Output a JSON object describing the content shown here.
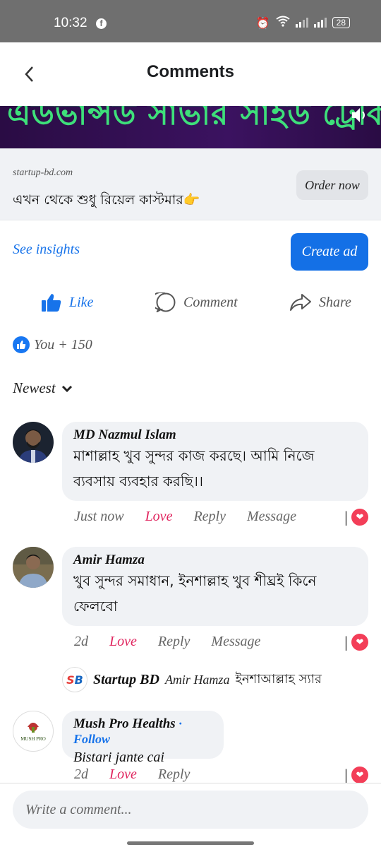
{
  "status_bar": {
    "time": "10:32",
    "battery": "28"
  },
  "header": {
    "title": "Comments",
    "back_icon": "chevron-left-icon"
  },
  "banner": {
    "text": "এডভান্সড সাভার সাইড ট্রেকিং"
  },
  "ad": {
    "domain": "startup-bd.com",
    "headline": "এখন থেকে শুধু রিয়েল কাস্টমার👉",
    "cta": "Order now"
  },
  "insights": {
    "see_insights": "See insights",
    "create_ad": "Create ad"
  },
  "actions": {
    "like": "Like",
    "comment": "Comment",
    "share": "Share"
  },
  "reactions": {
    "summary": "You + 150"
  },
  "sort": {
    "label": "Newest"
  },
  "comments": [
    {
      "name": "MD Nazmul Islam",
      "text": "মাশাল্লাহ খুব সুন্দর কাজ করছে। আমি নিজে ব্যবসায় ব্যবহার করছি।।",
      "time": "Just now",
      "love": "Love",
      "reply": "Reply",
      "message": "Message"
    },
    {
      "name": "Amir Hamza",
      "text": "খুব সুন্দর সমাধান, ইনশাল্লাহ খুব শীঘ্রই কিনে ফেলবো",
      "time": "2d",
      "love": "Love",
      "reply": "Reply",
      "message": "Message"
    },
    {
      "name": "Mush Pro Healths",
      "follow": "· Follow",
      "text": "Bistari jante cai",
      "time": "2d",
      "love": "Love",
      "reply": "Reply"
    }
  ],
  "reply": {
    "name": "Startup BD",
    "mention": "Amir Hamza",
    "text": "ইনশাআল্লাহ স্যার"
  },
  "composer": {
    "placeholder": "Write a comment..."
  },
  "colors": {
    "accent": "#1773ea",
    "love": "#e0245e",
    "bubble": "#f0f2f5"
  }
}
